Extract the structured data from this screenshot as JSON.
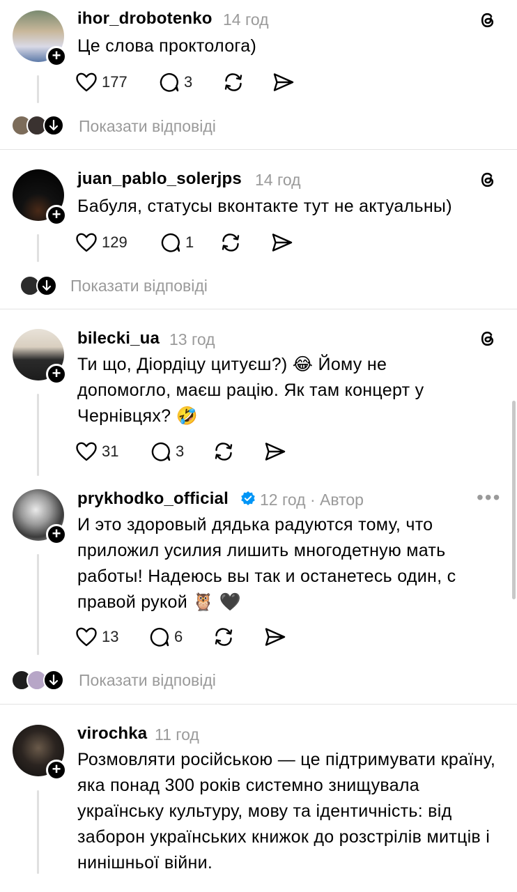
{
  "posts": [
    {
      "username": "ihor_drobotenko",
      "time": "14 год",
      "text": "Це слова проктолога)",
      "likes": "177",
      "replies": "3"
    },
    {
      "username": "juan_pablo_solerjps",
      "time": "14 год",
      "text": "Бабуля, статусы вконтакте тут не актуальны)",
      "likes": "129",
      "replies": "1"
    },
    {
      "username": "bilecki_ua",
      "time": "13 год",
      "text": "Ти що, Діордіцу цитуєш?) 😂 Йому не допомогло, маєш рацію. Як там концерт у Чернівцях? 🤣",
      "likes": "31",
      "replies": "3"
    },
    {
      "username": "prykhodko_official",
      "time": "12 год · Автор",
      "text": "И это здоровый дядька радуются тому, что приложил  усилия лишить многодетную мать работы! Надеюсь вы так и останетесь один, с правой рукой 🦉 🖤",
      "likes": "13",
      "replies": "6"
    },
    {
      "username": "virochka",
      "time": "11 год",
      "text": "Розмовляти російською — це підтримувати країну, яка понад 300 років системно знищувала українську культуру, мову та ідентичність: від заборон українських книжок до розстрілів митців і нинішньої війни.",
      "likes": "",
      "replies": ""
    }
  ],
  "show_replies_label": "Показати відповіді",
  "colors": {
    "muted": "#9a9a9a",
    "verified": "#0095f6"
  }
}
